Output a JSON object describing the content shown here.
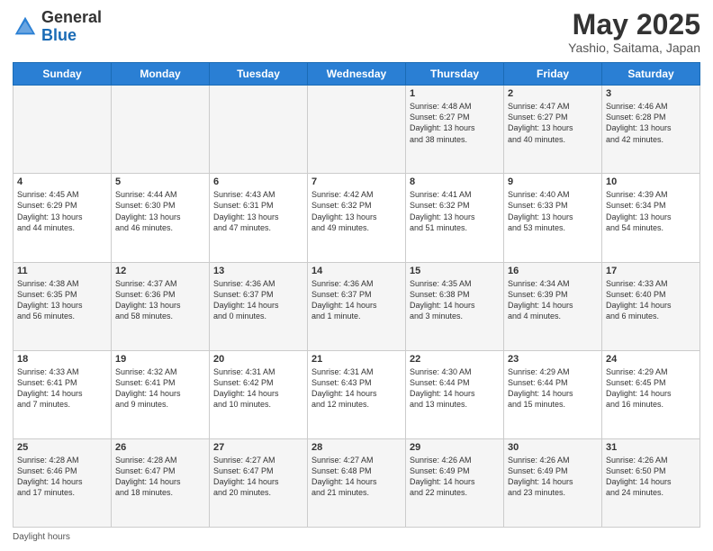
{
  "header": {
    "logo_general": "General",
    "logo_blue": "Blue",
    "month_title": "May 2025",
    "location": "Yashio, Saitama, Japan"
  },
  "days_of_week": [
    "Sunday",
    "Monday",
    "Tuesday",
    "Wednesday",
    "Thursday",
    "Friday",
    "Saturday"
  ],
  "footer": {
    "daylight_label": "Daylight hours"
  },
  "weeks": [
    [
      {
        "num": "",
        "info": ""
      },
      {
        "num": "",
        "info": ""
      },
      {
        "num": "",
        "info": ""
      },
      {
        "num": "",
        "info": ""
      },
      {
        "num": "1",
        "info": "Sunrise: 4:48 AM\nSunset: 6:27 PM\nDaylight: 13 hours\nand 38 minutes."
      },
      {
        "num": "2",
        "info": "Sunrise: 4:47 AM\nSunset: 6:27 PM\nDaylight: 13 hours\nand 40 minutes."
      },
      {
        "num": "3",
        "info": "Sunrise: 4:46 AM\nSunset: 6:28 PM\nDaylight: 13 hours\nand 42 minutes."
      }
    ],
    [
      {
        "num": "4",
        "info": "Sunrise: 4:45 AM\nSunset: 6:29 PM\nDaylight: 13 hours\nand 44 minutes."
      },
      {
        "num": "5",
        "info": "Sunrise: 4:44 AM\nSunset: 6:30 PM\nDaylight: 13 hours\nand 46 minutes."
      },
      {
        "num": "6",
        "info": "Sunrise: 4:43 AM\nSunset: 6:31 PM\nDaylight: 13 hours\nand 47 minutes."
      },
      {
        "num": "7",
        "info": "Sunrise: 4:42 AM\nSunset: 6:32 PM\nDaylight: 13 hours\nand 49 minutes."
      },
      {
        "num": "8",
        "info": "Sunrise: 4:41 AM\nSunset: 6:32 PM\nDaylight: 13 hours\nand 51 minutes."
      },
      {
        "num": "9",
        "info": "Sunrise: 4:40 AM\nSunset: 6:33 PM\nDaylight: 13 hours\nand 53 minutes."
      },
      {
        "num": "10",
        "info": "Sunrise: 4:39 AM\nSunset: 6:34 PM\nDaylight: 13 hours\nand 54 minutes."
      }
    ],
    [
      {
        "num": "11",
        "info": "Sunrise: 4:38 AM\nSunset: 6:35 PM\nDaylight: 13 hours\nand 56 minutes."
      },
      {
        "num": "12",
        "info": "Sunrise: 4:37 AM\nSunset: 6:36 PM\nDaylight: 13 hours\nand 58 minutes."
      },
      {
        "num": "13",
        "info": "Sunrise: 4:36 AM\nSunset: 6:37 PM\nDaylight: 14 hours\nand 0 minutes."
      },
      {
        "num": "14",
        "info": "Sunrise: 4:36 AM\nSunset: 6:37 PM\nDaylight: 14 hours\nand 1 minute."
      },
      {
        "num": "15",
        "info": "Sunrise: 4:35 AM\nSunset: 6:38 PM\nDaylight: 14 hours\nand 3 minutes."
      },
      {
        "num": "16",
        "info": "Sunrise: 4:34 AM\nSunset: 6:39 PM\nDaylight: 14 hours\nand 4 minutes."
      },
      {
        "num": "17",
        "info": "Sunrise: 4:33 AM\nSunset: 6:40 PM\nDaylight: 14 hours\nand 6 minutes."
      }
    ],
    [
      {
        "num": "18",
        "info": "Sunrise: 4:33 AM\nSunset: 6:41 PM\nDaylight: 14 hours\nand 7 minutes."
      },
      {
        "num": "19",
        "info": "Sunrise: 4:32 AM\nSunset: 6:41 PM\nDaylight: 14 hours\nand 9 minutes."
      },
      {
        "num": "20",
        "info": "Sunrise: 4:31 AM\nSunset: 6:42 PM\nDaylight: 14 hours\nand 10 minutes."
      },
      {
        "num": "21",
        "info": "Sunrise: 4:31 AM\nSunset: 6:43 PM\nDaylight: 14 hours\nand 12 minutes."
      },
      {
        "num": "22",
        "info": "Sunrise: 4:30 AM\nSunset: 6:44 PM\nDaylight: 14 hours\nand 13 minutes."
      },
      {
        "num": "23",
        "info": "Sunrise: 4:29 AM\nSunset: 6:44 PM\nDaylight: 14 hours\nand 15 minutes."
      },
      {
        "num": "24",
        "info": "Sunrise: 4:29 AM\nSunset: 6:45 PM\nDaylight: 14 hours\nand 16 minutes."
      }
    ],
    [
      {
        "num": "25",
        "info": "Sunrise: 4:28 AM\nSunset: 6:46 PM\nDaylight: 14 hours\nand 17 minutes."
      },
      {
        "num": "26",
        "info": "Sunrise: 4:28 AM\nSunset: 6:47 PM\nDaylight: 14 hours\nand 18 minutes."
      },
      {
        "num": "27",
        "info": "Sunrise: 4:27 AM\nSunset: 6:47 PM\nDaylight: 14 hours\nand 20 minutes."
      },
      {
        "num": "28",
        "info": "Sunrise: 4:27 AM\nSunset: 6:48 PM\nDaylight: 14 hours\nand 21 minutes."
      },
      {
        "num": "29",
        "info": "Sunrise: 4:26 AM\nSunset: 6:49 PM\nDaylight: 14 hours\nand 22 minutes."
      },
      {
        "num": "30",
        "info": "Sunrise: 4:26 AM\nSunset: 6:49 PM\nDaylight: 14 hours\nand 23 minutes."
      },
      {
        "num": "31",
        "info": "Sunrise: 4:26 AM\nSunset: 6:50 PM\nDaylight: 14 hours\nand 24 minutes."
      }
    ]
  ]
}
